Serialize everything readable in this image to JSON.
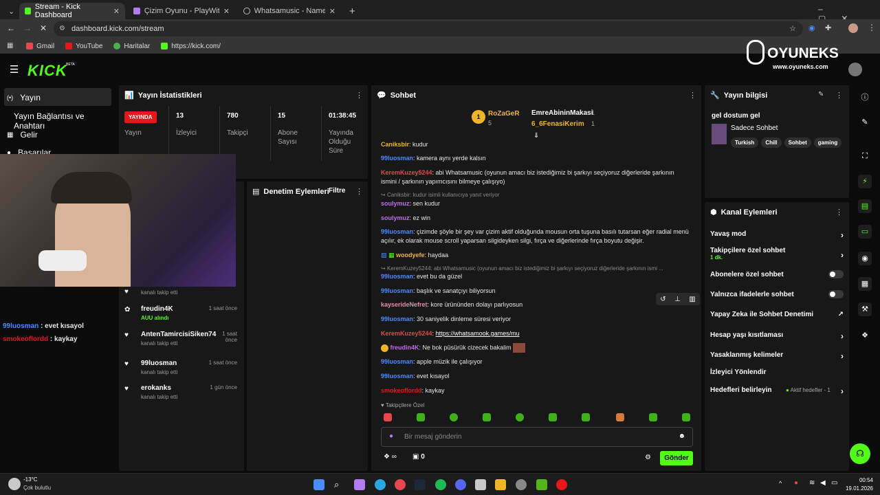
{
  "browser": {
    "tabs": [
      {
        "title": "Stream - Kick Dashboard",
        "active": true
      },
      {
        "title": "Çizim Oyunu - PlayWithKick.AP",
        "active": false
      },
      {
        "title": "Whatsamusic - Name That Tun",
        "active": false
      }
    ],
    "url": "dashboard.kick.com/stream",
    "bookmarks": [
      "Gmail",
      "YouTube",
      "Haritalar",
      "https://kick.com/"
    ]
  },
  "brand": {
    "logo": "KICK",
    "beta": "BETA",
    "watermark": "OYUNEKS",
    "watermark_url": "www.oyuneks.com",
    "accent": "#53fc18"
  },
  "nav": {
    "items": [
      {
        "label": "Yayın",
        "icon": "broadcast-icon"
      },
      {
        "label": "Yayın Bağlantısı ve Anahtarı",
        "icon": "key-icon"
      },
      {
        "label": "Gelir",
        "icon": "money-icon"
      },
      {
        "label": "Başarılar",
        "icon": "trophy-icon"
      }
    ]
  },
  "stats": {
    "title": "Yayın İstatistikleri",
    "live_label": "YAYINDA",
    "live_sub": "Yayın",
    "items": [
      {
        "value": "13",
        "label": "İzleyici"
      },
      {
        "value": "780",
        "label": "Takipçi"
      },
      {
        "value": "15",
        "label": "Abone Sayısı"
      },
      {
        "value": "01:38:45",
        "label": "Yayında Olduğu Süre"
      }
    ]
  },
  "moderation": {
    "title": "Denetim Eylemleri",
    "filter": "Filtre"
  },
  "activity": [
    {
      "name": "",
      "sub": "kanalı takip etti",
      "time": "",
      "icon": "heart-icon"
    },
    {
      "name": "freudin4K",
      "sub": "AUU alındı",
      "time": "1 saat önce",
      "icon": "gift-icon"
    },
    {
      "name": "AntenTamircisiSiken74",
      "sub": "kanalı takip etti",
      "time": "1 saat önce",
      "icon": "heart-icon"
    },
    {
      "name": "99luosman",
      "sub": "kanalı takip etti",
      "time": "1 saat önce",
      "icon": "heart-icon"
    },
    {
      "name": "erokanks",
      "sub": "kanalı takip etti",
      "time": "1 gün önce",
      "icon": "heart-icon"
    }
  ],
  "overlay_chat": [
    {
      "user": "99luosman",
      "text": " : evet kısayol",
      "color": "#4a8cff"
    },
    {
      "user": "smokeoflordd",
      "text": " : kaykay",
      "color": "#e5171a"
    }
  ],
  "chat": {
    "title": "Sohbet",
    "leaders": [
      {
        "name": "RoZaGeR",
        "count": "5",
        "rank": "1"
      },
      {
        "name": "EmreAbininMakasi",
        "count": "1"
      },
      {
        "name": "6_6FenasiKerim",
        "count": "1"
      }
    ],
    "messages": [
      {
        "user": "Caniksbir",
        "color": "#f0b429",
        "text": ": kudur"
      },
      {
        "user": "99luosman",
        "color": "#4a8cff",
        "text": ": kamera aynı yerde kalsın"
      },
      {
        "user": "KeremKuzey5244",
        "color": "#e5474a",
        "text": ": abi Whatsamusic (oyunun amacı biz istediğimiz bi şarkıyı seçiyoruz diğerleride şarkının ismini / şarkının yapımcısını bilmeye çalışıyo)"
      },
      {
        "reply": "Caniksbir: kudur isimli kullanıcıya yanıt veriyor"
      },
      {
        "user": "soulymuz",
        "color": "#c06cf0",
        "text": ": sen kudur"
      },
      {
        "user": "soulymuz",
        "color": "#c06cf0",
        "text": ": ez win"
      },
      {
        "user": "99luosman",
        "color": "#4a8cff",
        "text": ": çizimde şöyle bir şey var çizim aktif olduğunda mousun orta tuşuna basılı tutarsan eğer radial menü açılır, ek olarak mouse scroll yaparsan silgideyken silgi, fırça ve diğerlerinde fırça boyutu değişir."
      },
      {
        "user": "woodyefe",
        "color": "#f0b429",
        "text": ": haydaa"
      },
      {
        "reply": "KeremKuzey5244: abi Whatsamusic (oyunun amacı biz istediğimiz bi şarkıyı seçiyoruz diğerleride şarkının ismi ..."
      },
      {
        "user": "99luosman",
        "color": "#4a8cff",
        "text": ": evet bu da güzel"
      },
      {
        "user": "99luosman",
        "color": "#4a8cff",
        "text": ": başlık ve sanatçıyı biliyorsun"
      },
      {
        "user": "kayserideNefret",
        "color": "#e88aa8",
        "text": ": kore ürününden dolayı parlıyosun"
      },
      {
        "user": "99luosman",
        "color": "#4a8cff",
        "text": ": 30 saniyelik dinleme süresi veriyor"
      },
      {
        "user": "KeremKuzey5244",
        "color": "#e5474a",
        "text": ": ",
        "link": "https://whatsamook.games/mu"
      },
      {
        "user": "freudin4K",
        "color": "#c06cf0",
        "text": ": Ne bok püsürük cizecek bakalim"
      },
      {
        "user": "99luosman",
        "color": "#4a8cff",
        "text": ": apple müzik ile çalışıyor"
      },
      {
        "user": "99luosman",
        "color": "#4a8cff",
        "text": ": evet kısayol"
      },
      {
        "user": "smokeoflordd",
        "color": "#e5171a",
        "text": ": kaykay"
      }
    ],
    "followers_only": "Takipçilere Özel",
    "input_placeholder": "Bir mesaj gönderin",
    "points": "∞",
    "cart_count": "0",
    "send_label": "Gönder"
  },
  "stream_info": {
    "title": "Yayın bilgisi",
    "stream_title": "gel dostum gel",
    "category": "Sadece Sohbet",
    "tags": [
      "Turkish",
      "Chill",
      "Sohbet",
      "gaming"
    ]
  },
  "channel_actions": {
    "title": "Kanal Eylemleri",
    "items": [
      {
        "label": "Yavaş mod",
        "control": "chevron"
      },
      {
        "label": "Takipçilere özel sohbet",
        "sub": "1 dk.",
        "control": "chevron"
      },
      {
        "label": "Abonelere özel sohbet",
        "control": "toggle"
      },
      {
        "label": "Yalnızca ifadelerle sohbet",
        "control": "toggle"
      },
      {
        "label": "Yapay Zeka ile Sohbet Denetimi",
        "control": "external"
      },
      {
        "label": "Hesap yaşı kısıtlaması",
        "control": "chevron"
      },
      {
        "label": "Yasaklanmış kelimeler",
        "control": "chevron"
      },
      {
        "label": "İzleyici Yönlendir",
        "control": "none"
      },
      {
        "label": "Hedefleri belirleyin",
        "extra": "Aktif hedefler - 1",
        "control": "chevron"
      }
    ]
  },
  "taskbar": {
    "weather_temp": "-13°C",
    "weather_desc": "Çok bulutlu",
    "time": "00:54",
    "date": "19.01.2026"
  }
}
